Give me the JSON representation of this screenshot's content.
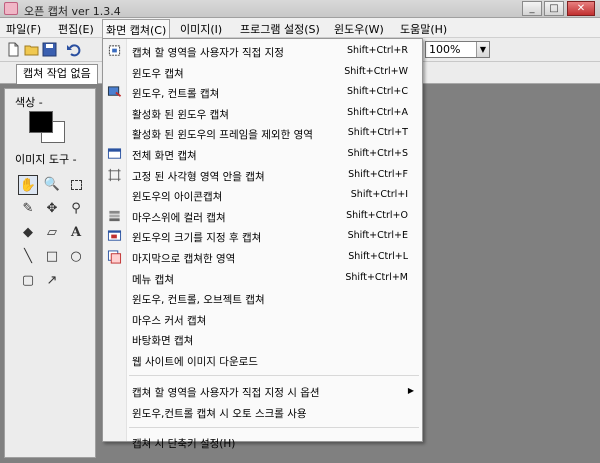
{
  "window": {
    "title": "오픈 캡처 ver 1.3.4",
    "minimize": "_",
    "maximize": "□",
    "close": "✕"
  },
  "menubar": [
    {
      "label": "파일(F)"
    },
    {
      "label": "편집(E)"
    },
    {
      "label": "화면 캡쳐(C)"
    },
    {
      "label": "이미지(I)"
    },
    {
      "label": "프로그램 설정(S)"
    },
    {
      "label": "윈도우(W)"
    },
    {
      "label": "도움말(H)"
    }
  ],
  "toolbar": {
    "zoom": "100%"
  },
  "tabs": [
    {
      "label": "캡쳐 작업 없음"
    }
  ],
  "sidebar": {
    "color_label": "색상 -",
    "tools_label": "이미지 도구 -",
    "colors": {
      "foreground": "#000000",
      "background": "#ffffff"
    },
    "tools": [
      "hand-icon",
      "magnifier-icon",
      "select-rect-icon",
      "pencil-icon",
      "airbrush-icon",
      "eyedropper-icon",
      "fill-icon",
      "eraser-icon",
      "text-icon",
      "line-icon",
      "rectangle-icon",
      "ellipse-icon",
      "rounded-rect-icon",
      "arrow-icon"
    ]
  },
  "capture_menu": {
    "items": [
      {
        "label": "캡쳐 할 영역을 사용자가 직접 지정",
        "shortcut": "Shift+Ctrl+R",
        "icon": "region-icon"
      },
      {
        "label": "윈도우 캡쳐",
        "shortcut": "Shift+Ctrl+W",
        "icon": ""
      },
      {
        "label": "윈도우, 컨트롤 캡쳐",
        "shortcut": "Shift+Ctrl+C",
        "icon": "window-control-icon"
      },
      {
        "label": "활성화 된 윈도우 캡쳐",
        "shortcut": "Shift+Ctrl+A",
        "icon": ""
      },
      {
        "label": "활성화 된 윈도우의 프레임을 제외한 영역",
        "shortcut": "Shift+Ctrl+T",
        "icon": ""
      },
      {
        "label": "전체 화면 캡쳐",
        "shortcut": "Shift+Ctrl+S",
        "icon": "fullscreen-icon"
      },
      {
        "label": "고정 된 사각형 영역 안을 캡쳐",
        "shortcut": "Shift+Ctrl+F",
        "icon": "fixed-rect-icon"
      },
      {
        "label": "윈도우의 아이콘캡쳐",
        "shortcut": "Shift+Ctrl+I",
        "icon": ""
      },
      {
        "label": "마우스위에 컬러 캡쳐",
        "shortcut": "Shift+Ctrl+O",
        "icon": "color-bars-icon"
      },
      {
        "label": "윈도우의 크기를 지정 후 캡쳐",
        "shortcut": "Shift+Ctrl+E",
        "icon": "resize-window-icon"
      },
      {
        "label": "마지막으로 캡쳐한 영역",
        "shortcut": "Shift+Ctrl+L",
        "icon": "last-region-icon"
      },
      {
        "label": "메뉴 캡쳐",
        "shortcut": "Shift+Ctrl+M",
        "icon": ""
      },
      {
        "label": "윈도우, 컨트롤, 오브젝트 캡쳐",
        "shortcut": "",
        "icon": ""
      },
      {
        "label": "마우스 커서 캡쳐",
        "shortcut": "",
        "icon": ""
      },
      {
        "label": "바탕화면 캡쳐",
        "shortcut": "",
        "icon": ""
      },
      {
        "label": "웹 사이트에 이미지 다운로드",
        "shortcut": "",
        "icon": ""
      }
    ],
    "options": [
      {
        "label": "캡쳐 할 영역을 사용자가 직접 지정 시 옵션",
        "submenu": "▶"
      },
      {
        "label": "윈도우,컨트롤 캡쳐 시 오토 스크롤 사용"
      }
    ],
    "hotkey": {
      "label": "캡쳐 시 단축키 설정(H)"
    }
  }
}
